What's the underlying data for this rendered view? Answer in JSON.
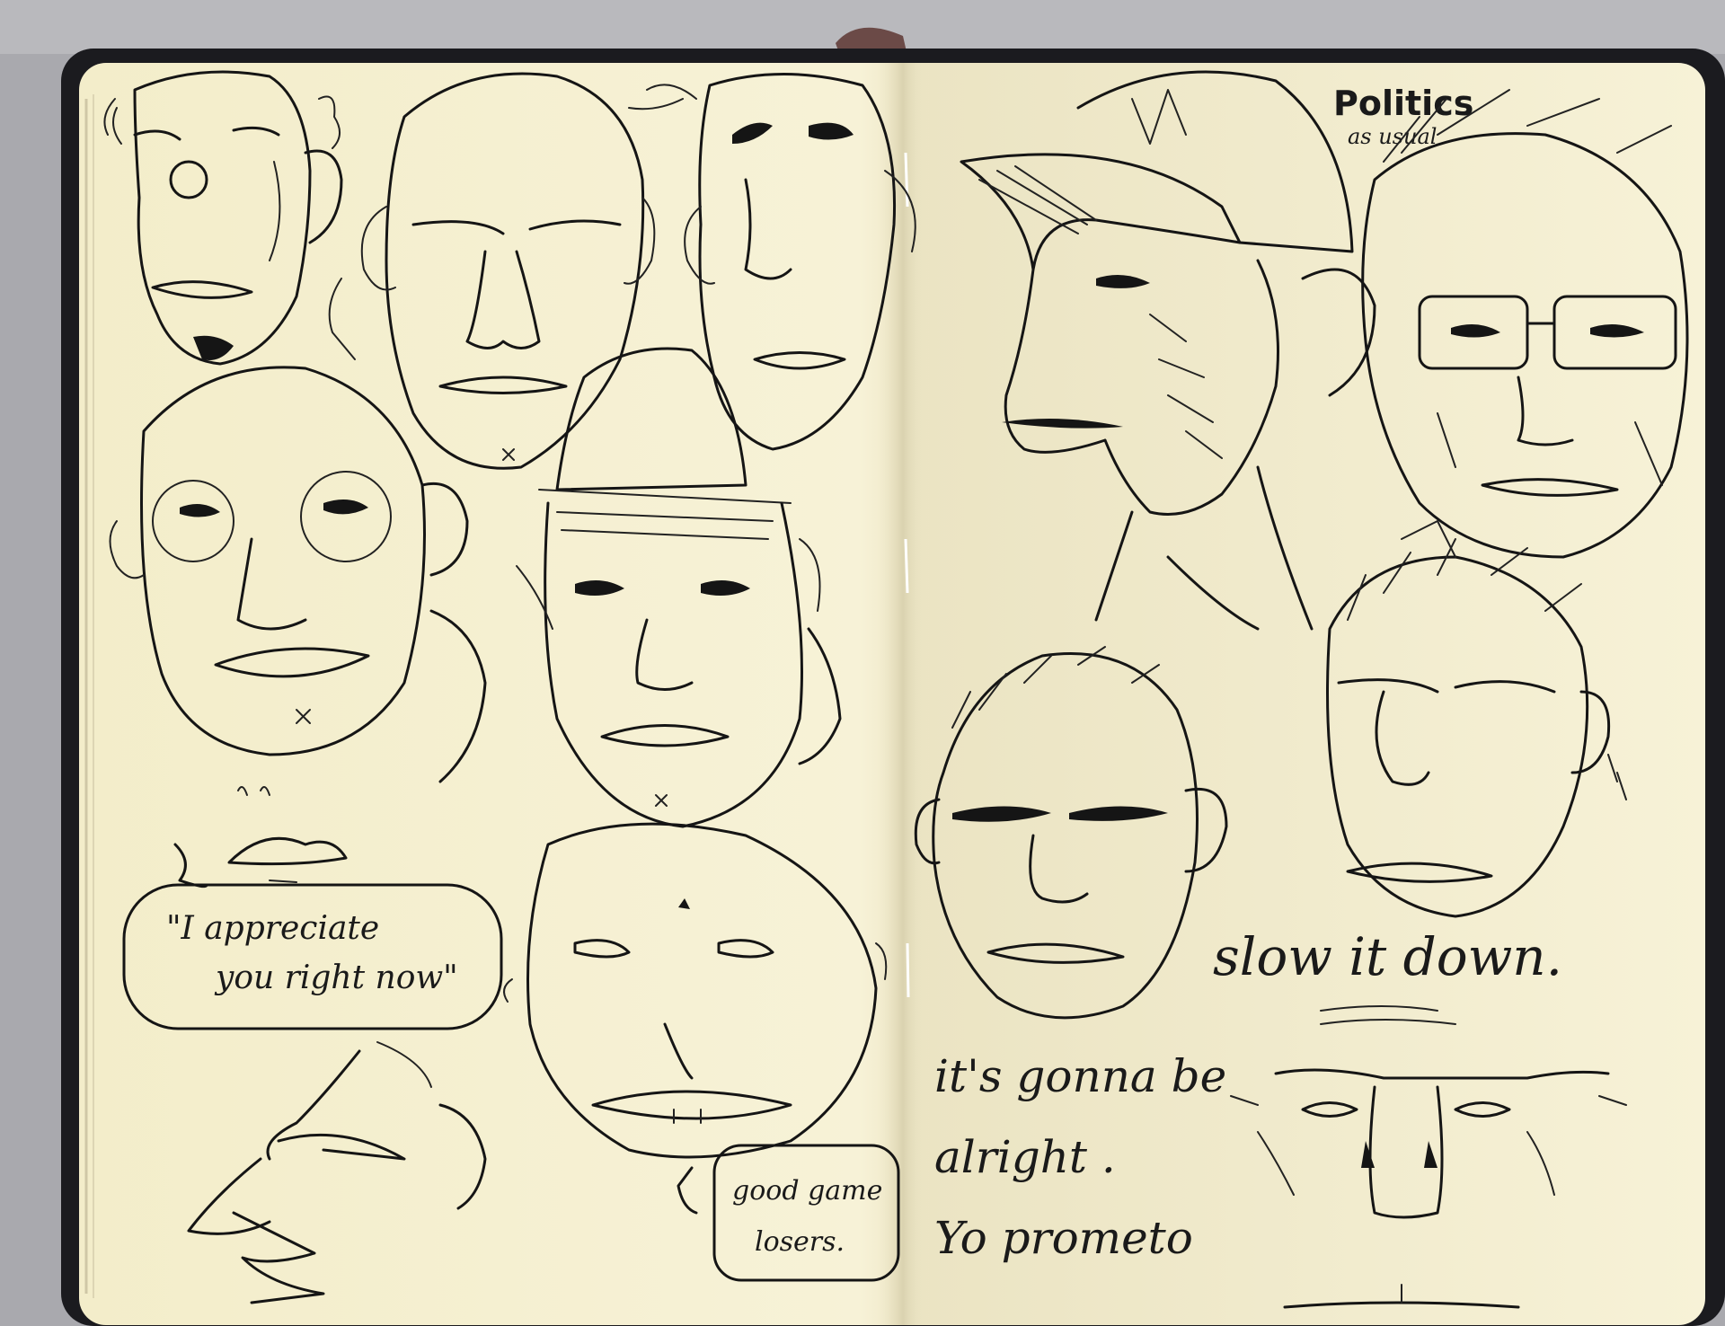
{
  "colors": {
    "background_gray": "#a6a6ab",
    "notebook_cover": "#1b1b1f",
    "paper": "#f6f1d4",
    "ink": "#151515"
  },
  "captions": {
    "politics": "Politics",
    "as_usual": "as usual",
    "slow_it_down": "slow it down.",
    "gonna_be_1": "it's gonna be",
    "gonna_be_2": "alright .",
    "gonna_be_3": "Yo prometo",
    "appreciate_1": "\"I appreciate",
    "appreciate_2": "you right now\"",
    "good_game_1": "good game",
    "good_game_2": "losers."
  }
}
